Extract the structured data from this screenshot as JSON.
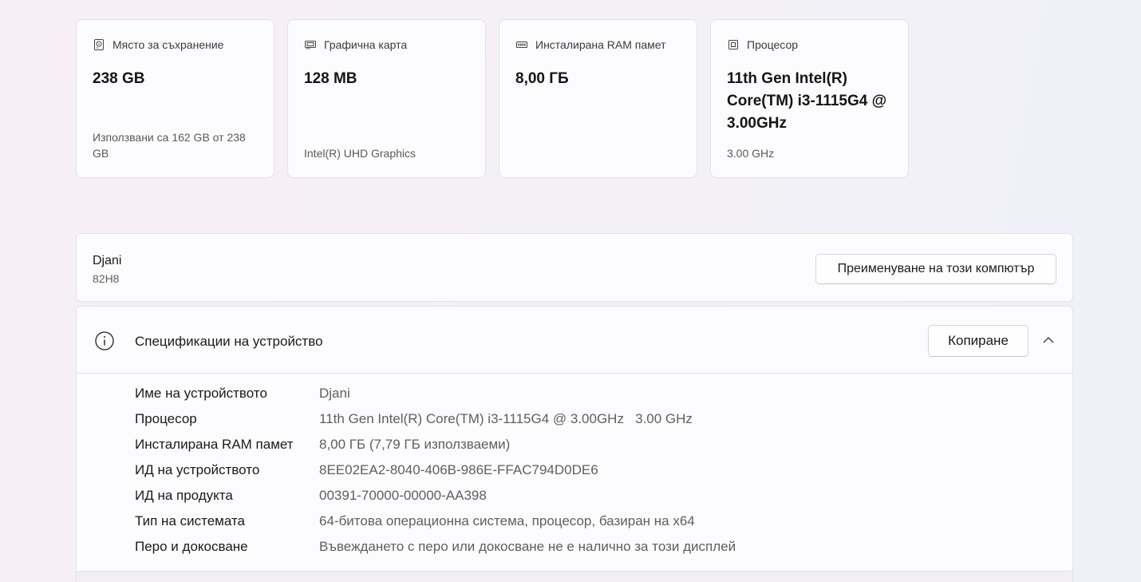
{
  "cards": [
    {
      "icon": "storage-icon",
      "label": "Място за съхранение",
      "value": "238 GB",
      "sub": "Използвани са 162 GB от 238 GB"
    },
    {
      "icon": "graphics-card-icon",
      "label": "Графична карта",
      "value": "128 MB",
      "sub": "Intel(R) UHD Graphics"
    },
    {
      "icon": "ram-icon",
      "label": "Инсталирана RAM памет",
      "value": "8,00 ГБ",
      "sub": ""
    },
    {
      "icon": "processor-icon",
      "label": "Процесор",
      "value": "11th Gen Intel(R) Core(TM) i3-1115G4 @ 3.00GHz",
      "sub": "3.00 GHz"
    }
  ],
  "device": {
    "name": "Djani",
    "model": "82H8",
    "rename_label": "Преименуване на този компютър"
  },
  "specs": {
    "title": "Спецификации на устройство",
    "copy_label": "Копиране",
    "rows": [
      {
        "label": "Име на устройството",
        "value": "Djani"
      },
      {
        "label": "Процесор",
        "value": "11th Gen Intel(R) Core(TM) i3-1115G4 @ 3.00GHz   3.00 GHz"
      },
      {
        "label": "Инсталирана RAM памет",
        "value": "8,00 ГБ (7,79 ГБ използваеми)"
      },
      {
        "label": "ИД на устройството",
        "value": "8EE02EA2-8040-406B-986E-FFAC794D0DE6"
      },
      {
        "label": "ИД на продукта",
        "value": "00391-70000-00000-AA398"
      },
      {
        "label": "Тип на системата",
        "value": "64-битова операционна система, процесор, базиран на x64"
      },
      {
        "label": "Перо и докосване",
        "value": "Въвеждането с перо или докосване не е налично за този дисплей"
      }
    ]
  }
}
